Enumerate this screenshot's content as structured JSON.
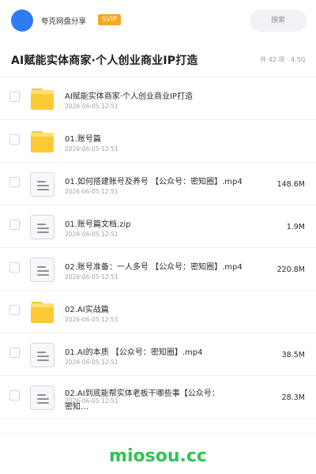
{
  "header": {
    "username": "夸克网盘分享",
    "badge": "SVIP",
    "search_label": "搜索"
  },
  "folder": {
    "title": "AI赋能实体商家·个人创业商业IP打造",
    "summary": "共 42 项 · 4.5G"
  },
  "items": [
    {
      "type": "folder",
      "name": "AI赋能实体商家·个人创业商业IP打造",
      "date": "2026-06-05 12:51",
      "size": ""
    },
    {
      "type": "folder",
      "name": "01.账号篇",
      "date": "2026-06-05 12:51",
      "size": ""
    },
    {
      "type": "file",
      "name": "01.如何搭建账号及养号 【公众号：密知圈】.mp4",
      "date": "2026-06-05 12:51",
      "size": "148.6M"
    },
    {
      "type": "file",
      "name": "01.账号篇文档.zip",
      "date": "2026-06-05 12:51",
      "size": "1.9M"
    },
    {
      "type": "file",
      "name": "02.账号准备：一人多号 【公众号：密知圈】.mp4",
      "date": "2026-06-05 12:51",
      "size": "220.8M"
    },
    {
      "type": "folder",
      "name": "02.AI实战篇",
      "date": "2026-06-05 12:51",
      "size": ""
    },
    {
      "type": "file",
      "name": "01.AI的本质 【公众号：密知圈】.mp4",
      "date": "2026-06-05 12:51",
      "size": "38.5M"
    },
    {
      "type": "file",
      "name": "02.AI到底能帮实体老板干哪些事【公众号：密知…",
      "date": "2026-06-05 12:51",
      "size": "28.3M"
    }
  ],
  "watermark": "miosou.cc"
}
